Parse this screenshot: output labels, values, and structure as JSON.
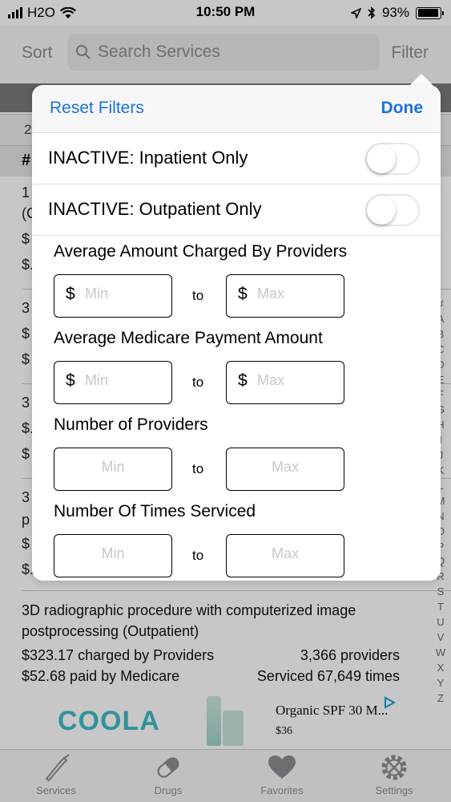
{
  "status_bar": {
    "carrier": "H2O",
    "time": "10:50 PM",
    "battery": "93%",
    "battery_level": 0.93
  },
  "top_bar": {
    "sort_label": "Sort",
    "search_placeholder": "Search Services",
    "filter_label": "Filter"
  },
  "background": {
    "header": "#",
    "rows": [
      {
        "line1": "1",
        "line2": "(C",
        "line3": "$",
        "line4": "$."
      },
      {
        "line1": "3",
        "line2": "$",
        "line3": "$"
      },
      {
        "line1": "3",
        "line2": "$.",
        "line3": "$"
      },
      {
        "line1": "3",
        "line2": "p",
        "line3": "$",
        "line4": "$."
      }
    ],
    "segment_label": "2",
    "visible_item": {
      "title": "3D radiographic procedure with computerized image postprocessing (Outpatient)",
      "charged": "$323.17 charged by Providers",
      "providers": "3,366 providers",
      "paid": "$52.68 paid by Medicare",
      "serviced": "Serviced 67,649 times"
    },
    "index_letters": [
      "#",
      "A",
      "B",
      "C",
      "D",
      "E",
      "F",
      "G",
      "H",
      "I",
      "J",
      "K",
      "L",
      "M",
      "N",
      "O",
      "P",
      "Q",
      "R",
      "S",
      "T",
      "U",
      "V",
      "W",
      "X",
      "Y",
      "Z"
    ]
  },
  "filter_popover": {
    "reset_label": "Reset Filters",
    "done_label": "Done",
    "toggles": [
      {
        "label": "INACTIVE: Inpatient Only",
        "on": false
      },
      {
        "label": "INACTIVE: Outpatient Only",
        "on": false
      }
    ],
    "ranges": [
      {
        "label": "Average Amount Charged By Providers",
        "currency": "$",
        "min_placeholder": "Min",
        "max_placeholder": "Max",
        "to": "to"
      },
      {
        "label": "Average Medicare Payment Amount",
        "currency": "$",
        "min_placeholder": "Min",
        "max_placeholder": "Max",
        "to": "to"
      },
      {
        "label": "Number of Providers",
        "currency": "",
        "min_placeholder": "Min",
        "max_placeholder": "Max",
        "to": "to"
      },
      {
        "label": "Number Of Times Serviced",
        "currency": "",
        "min_placeholder": "Min",
        "max_placeholder": "Max",
        "to": "to"
      }
    ]
  },
  "ad": {
    "brand": "COOLA",
    "title": "Organic SPF 30 M...",
    "price": "$36",
    "choice_icon": "adchoices-icon"
  },
  "tab_bar": {
    "tabs": [
      {
        "label": "Services",
        "icon": "scalpel-icon"
      },
      {
        "label": "Drugs",
        "icon": "pill-icon"
      },
      {
        "label": "Favorites",
        "icon": "heart-icon"
      },
      {
        "label": "Settings",
        "icon": "gear-icon"
      }
    ]
  },
  "colors": {
    "accent": "#1a73d9",
    "tab_inactive": "#8e8e93",
    "ad_brand": "#3fbcc7"
  }
}
